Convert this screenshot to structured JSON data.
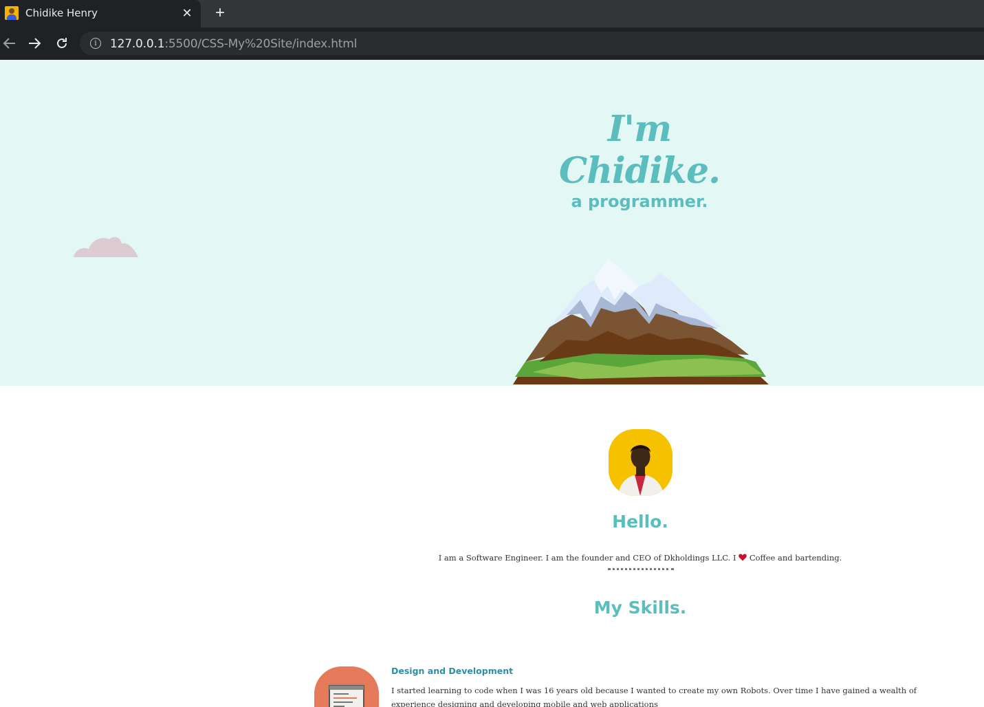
{
  "browser": {
    "tab_title": "Chidike Henry",
    "tab_close": "✕",
    "new_tab": "+",
    "url_host": "127.0.0.1",
    "url_rest": ":5500/CSS-My%20Site/index.html"
  },
  "hero": {
    "title": "I'm Chidike.",
    "subtitle": "a programmer."
  },
  "about": {
    "heading": "Hello.",
    "text_before_heart": "I am a Software Engineer. I am the founder and CEO of Dkholdings LLC. I",
    "text_after_heart": "Coffee and bartending."
  },
  "skills": {
    "heading": "My Skills.",
    "items": [
      {
        "title": "Design and Development",
        "description": "I started learning to code when I was 16 years old because I wanted to create my own Robots. Over time I have gained a wealth of experience designing and developing mobile and web applications"
      }
    ]
  },
  "colors": {
    "hero_bg": "#e3f8f5",
    "accent": "#5bbdbd",
    "skill_heading": "#2d8fa6",
    "skill_icon_bg": "#e57a5a",
    "avatar_bg": "#f6c200"
  }
}
